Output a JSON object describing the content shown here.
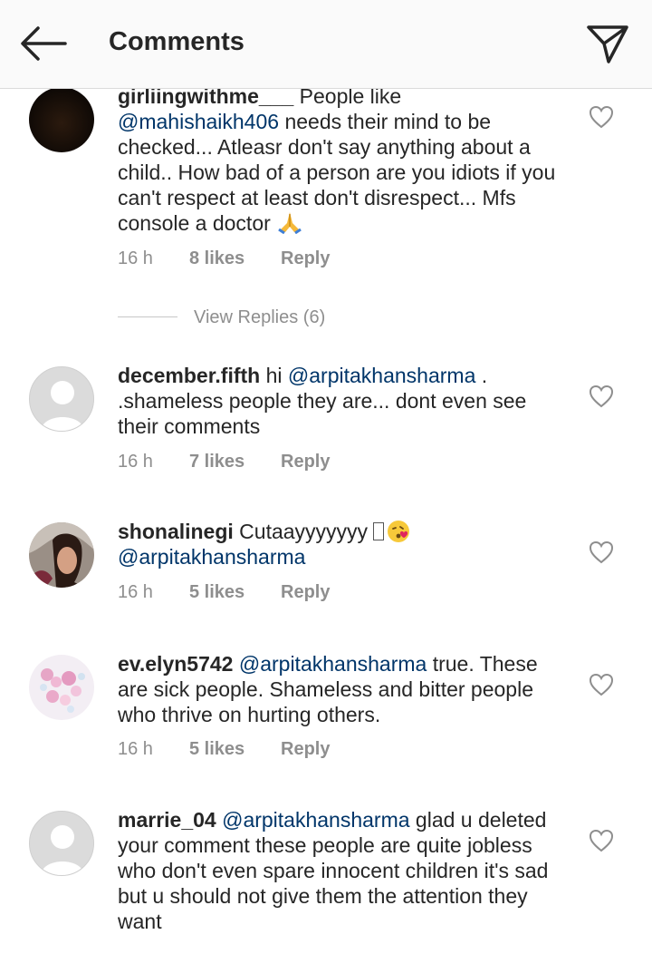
{
  "header": {
    "title": "Comments"
  },
  "comments": [
    {
      "username": "girliingwithme___",
      "text_before": " People like ",
      "mention": "@mahishaikh406",
      "text_after": " needs their mind to be checked... Atleasr don't say anything about a child.. How bad of a person are you idiots if you can't respect at least don't disrespect... Mfs console a doctor ",
      "emoji": "folded-hands-emoji",
      "time": "16 h",
      "likes": "8 likes",
      "reply": "Reply",
      "view_replies": "View Replies (6)"
    },
    {
      "username": "december.fifth",
      "text_before": " hi ",
      "mention": "@arpitakhansharma",
      "text_after": " . .shameless people they are... dont even see their comments",
      "time": "16 h",
      "likes": "7 likes",
      "reply": "Reply"
    },
    {
      "username": "shonalinegi",
      "text_before": " Cutaayyyyyyy ",
      "mention": "@arpitakhansharma",
      "emoji": "kissing-face-emoji",
      "time": "16 h",
      "likes": "5 likes",
      "reply": "Reply"
    },
    {
      "username": "ev.elyn5742",
      "text_before": " ",
      "mention": "@arpitakhansharma",
      "text_after": " true. These are sick people. Shameless and bitter people who thrive on hurting others.",
      "time": "16 h",
      "likes": "5 likes",
      "reply": "Reply"
    },
    {
      "username": "marrie_04",
      "text_before": " ",
      "mention": "@arpitakhansharma",
      "text_after": " glad u deleted your comment these people are quite jobless who don't even spare innocent children it's sad but u should not give them the attention they want"
    }
  ],
  "colors": {
    "text": "#262626",
    "meta": "#8e8e8e",
    "mention": "#003569",
    "header_bg": "#fafafa"
  },
  "icons": [
    "back-arrow-icon",
    "direct-send-icon",
    "heart-icon"
  ]
}
